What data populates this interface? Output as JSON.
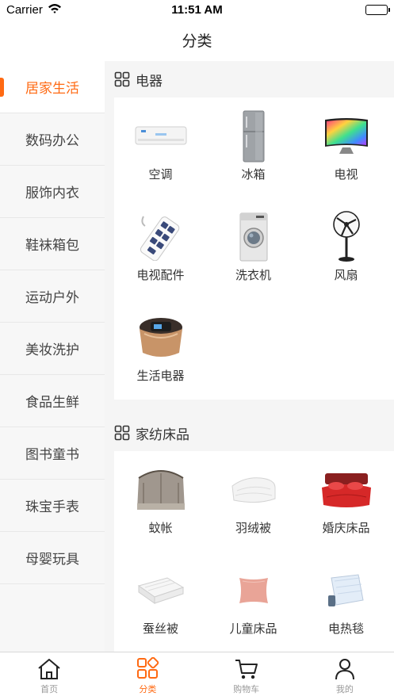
{
  "status_bar": {
    "carrier": "Carrier",
    "time": "11:51 AM"
  },
  "nav": {
    "title": "分类"
  },
  "sidebar": {
    "items": [
      {
        "label": "居家生活",
        "active": true
      },
      {
        "label": "数码办公"
      },
      {
        "label": "服饰内衣"
      },
      {
        "label": "鞋袜箱包"
      },
      {
        "label": "运动户外"
      },
      {
        "label": "美妆洗护"
      },
      {
        "label": "食品生鲜"
      },
      {
        "label": "图书童书"
      },
      {
        "label": "珠宝手表"
      },
      {
        "label": "母婴玩具"
      }
    ]
  },
  "sections": [
    {
      "title": "电器",
      "items": [
        {
          "label": "空调",
          "icon": "air-conditioner-icon"
        },
        {
          "label": "冰箱",
          "icon": "refrigerator-icon"
        },
        {
          "label": "电视",
          "icon": "tv-icon"
        },
        {
          "label": "电视配件",
          "icon": "power-strip-icon"
        },
        {
          "label": "洗衣机",
          "icon": "washing-machine-icon"
        },
        {
          "label": "风扇",
          "icon": "fan-icon"
        },
        {
          "label": "生活电器",
          "icon": "rice-cooker-icon"
        }
      ]
    },
    {
      "title": "家纺床品",
      "items": [
        {
          "label": "蚊帐",
          "icon": "mosquito-net-icon"
        },
        {
          "label": "羽绒被",
          "icon": "down-quilt-icon"
        },
        {
          "label": "婚庆床品",
          "icon": "wedding-bedding-icon"
        },
        {
          "label": "蚕丝被",
          "icon": "silk-quilt-icon"
        },
        {
          "label": "儿童床品",
          "icon": "pillow-icon"
        },
        {
          "label": "电热毯",
          "icon": "electric-blanket-icon"
        }
      ]
    }
  ],
  "tabbar": {
    "items": [
      {
        "label": "首页",
        "icon": "home-icon"
      },
      {
        "label": "分类",
        "icon": "category-icon",
        "active": true
      },
      {
        "label": "购物车",
        "icon": "cart-icon"
      },
      {
        "label": "我的",
        "icon": "user-icon"
      }
    ]
  },
  "colors": {
    "accent": "#ff6a13",
    "inactive": "#999999"
  }
}
